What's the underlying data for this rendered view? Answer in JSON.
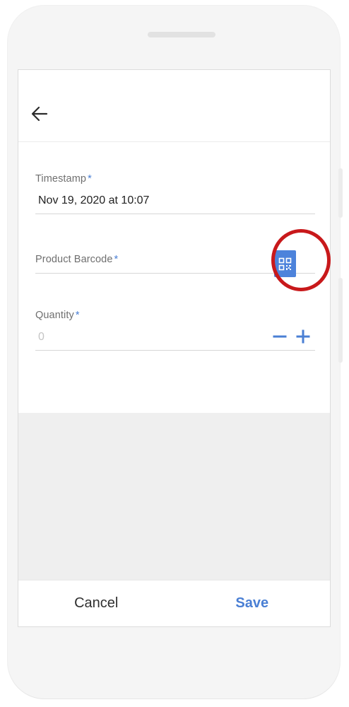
{
  "form": {
    "timestamp": {
      "label": "Timestamp",
      "required_mark": "*",
      "value": "Nov 19, 2020 at 10:07"
    },
    "barcode": {
      "label": "Product Barcode",
      "required_mark": "*",
      "value": ""
    },
    "quantity": {
      "label": "Quantity",
      "required_mark": "*",
      "placeholder": "0"
    }
  },
  "actions": {
    "cancel_label": "Cancel",
    "save_label": "Save"
  },
  "icons": {
    "back": "arrow-left-icon",
    "scan": "qr-code-icon",
    "decrement": "minus-icon",
    "increment": "plus-icon"
  },
  "colors": {
    "accent": "#4a7fd4",
    "scan_button": "#4d83db",
    "highlight": "#c8191b"
  }
}
